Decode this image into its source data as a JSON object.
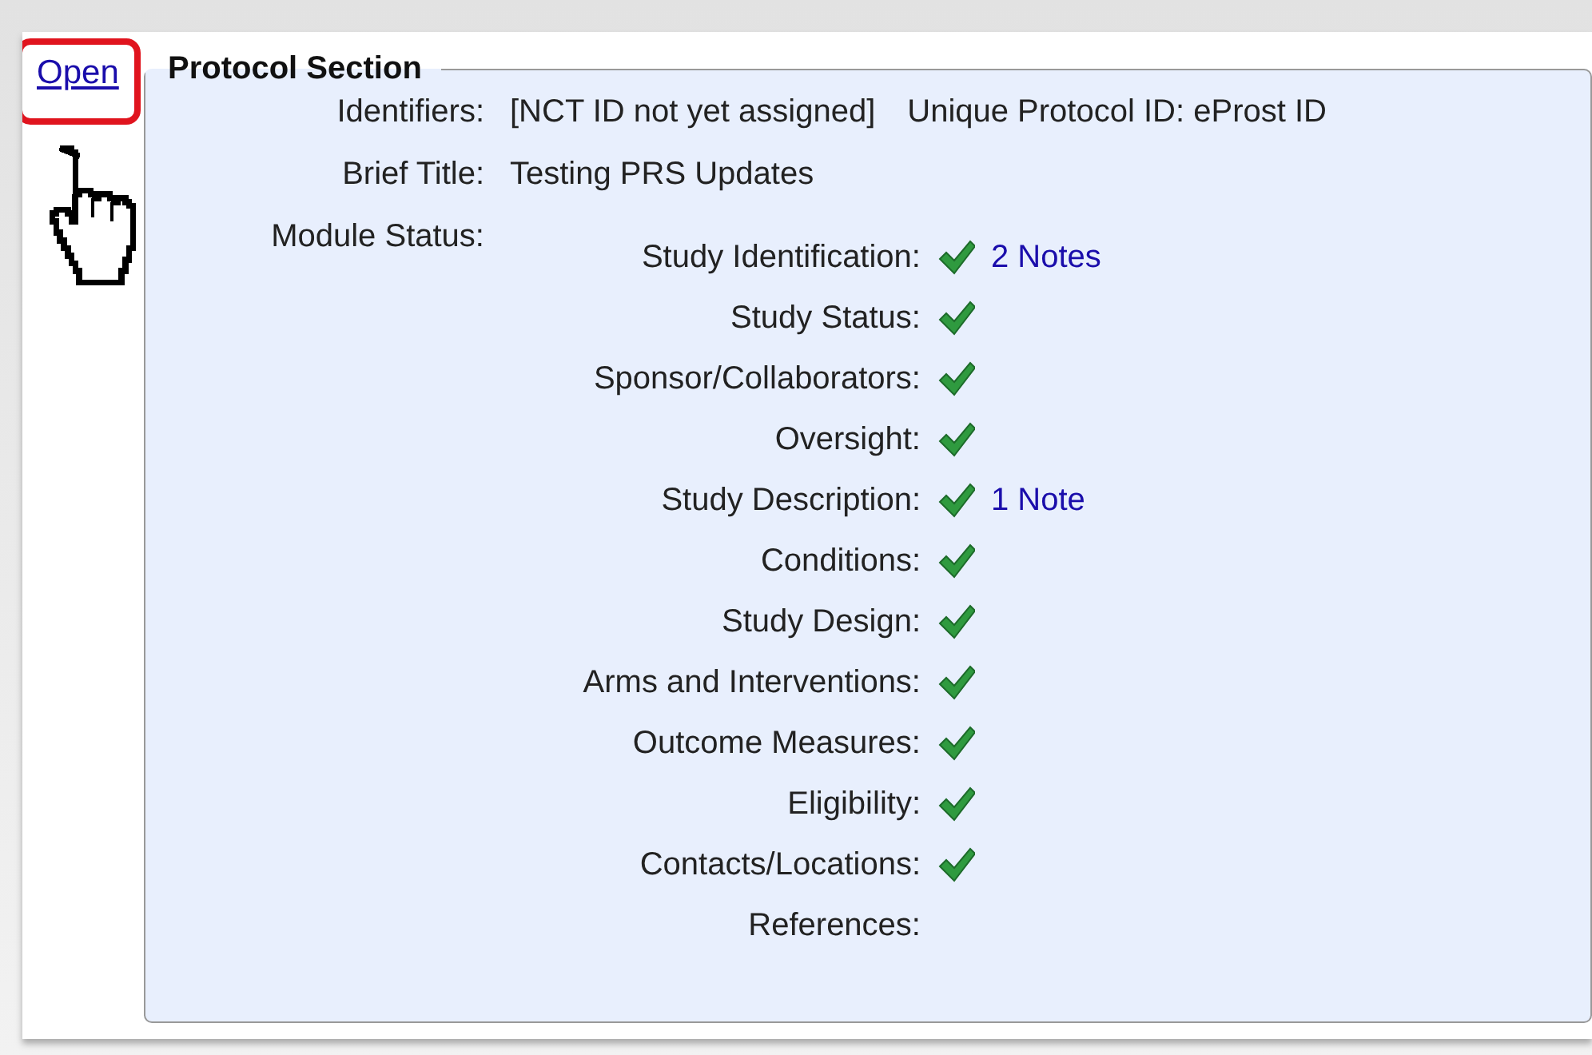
{
  "open_link": "Open",
  "section": {
    "title": "Protocol Section",
    "fields": [
      {
        "label": "Identifiers:",
        "values": [
          "[NCT ID not yet assigned]",
          "Unique Protocol ID: eProst ID"
        ]
      },
      {
        "label": "Brief Title:",
        "values": [
          "Testing PRS Updates"
        ]
      }
    ],
    "module_status_label": "Module Status:",
    "modules": [
      {
        "name": "Study Identification:",
        "complete": true,
        "note": "2 Notes"
      },
      {
        "name": "Study Status:",
        "complete": true
      },
      {
        "name": "Sponsor/Collaborators:",
        "complete": true
      },
      {
        "name": "Oversight:",
        "complete": true
      },
      {
        "name": "Study Description:",
        "complete": true,
        "note": "1 Note"
      },
      {
        "name": "Conditions:",
        "complete": true
      },
      {
        "name": "Study Design:",
        "complete": true
      },
      {
        "name": "Arms and Interventions:",
        "complete": true
      },
      {
        "name": "Outcome Measures:",
        "complete": true
      },
      {
        "name": "Eligibility:",
        "complete": true
      },
      {
        "name": "Contacts/Locations:",
        "complete": true
      },
      {
        "name": "References:",
        "complete": false
      }
    ]
  }
}
